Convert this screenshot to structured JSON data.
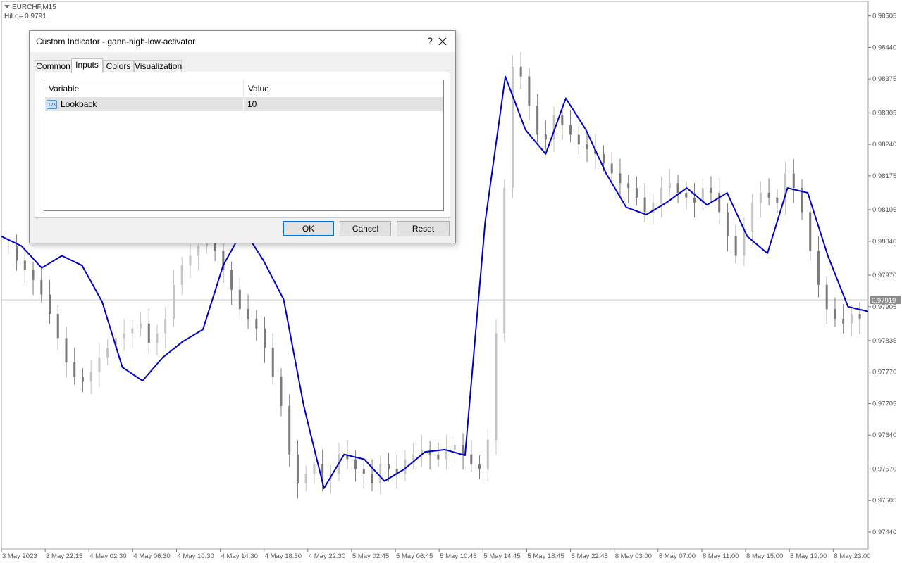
{
  "chart_data": {
    "type": "candlestick",
    "symbol": "EURCHF,M15",
    "indicator_readout": "HiLo= 0.9791",
    "current_price": "0.97919",
    "y_axis_ticks": [
      "0.98505",
      "0.98440",
      "0.98375",
      "0.98305",
      "0.98240",
      "0.98175",
      "0.98105",
      "0.98040",
      "0.97970",
      "0.97905",
      "0.97835",
      "0.97770",
      "0.97705",
      "0.97640",
      "0.97570",
      "0.97505",
      "0.97440"
    ],
    "y_range": [
      0.97405,
      0.98535
    ],
    "x_axis_labels": [
      "3 May 2023",
      "3 May 22:15",
      "4 May 02:30",
      "4 May 06:30",
      "4 May 10:30",
      "4 May 14:30",
      "4 May 18:30",
      "4 May 22:30",
      "5 May 02:45",
      "5 May 06:45",
      "5 May 10:45",
      "5 May 14:45",
      "5 May 18:45",
      "5 May 22:45",
      "8 May 03:00",
      "8 May 07:00",
      "8 May 11:00",
      "8 May 15:00",
      "8 May 19:00",
      "8 May 23:00"
    ],
    "series": [
      {
        "name": "HiLo",
        "color": "#0000c8",
        "values": [
          0.9805,
          0.9803,
          0.97985,
          0.9801,
          0.9799,
          0.97915,
          0.9778,
          0.97752,
          0.978,
          0.97833,
          0.97858,
          0.9799,
          0.98065,
          0.98,
          0.9792,
          0.977,
          0.9753,
          0.976,
          0.9759,
          0.97545,
          0.9757,
          0.97605,
          0.9761,
          0.97598,
          0.9808,
          0.9838,
          0.9827,
          0.9822,
          0.98335,
          0.9827,
          0.9818,
          0.9811,
          0.98095,
          0.9812,
          0.9815,
          0.98115,
          0.9814,
          0.9805,
          0.98015,
          0.9815,
          0.9814,
          0.9801,
          0.97905,
          0.97895
        ]
      }
    ],
    "candles_close": [
      0.9803,
      0.98,
      0.9798,
      0.9796,
      0.9793,
      0.9789,
      0.9784,
      0.9779,
      0.9776,
      0.9775,
      0.9777,
      0.978,
      0.9782,
      0.9784,
      0.9785,
      0.9786,
      0.9787,
      0.9783,
      0.9785,
      0.9788,
      0.9795,
      0.9799,
      0.9801,
      0.9803,
      0.9805,
      0.9802,
      0.9798,
      0.9794,
      0.979,
      0.9788,
      0.9786,
      0.9782,
      0.9776,
      0.977,
      0.976,
      0.9754,
      0.9756,
      0.9758,
      0.9755,
      0.9756,
      0.976,
      0.9759,
      0.9757,
      0.9756,
      0.9754,
      0.9758,
      0.9757,
      0.9756,
      0.9759,
      0.976,
      0.9761,
      0.976,
      0.9759,
      0.9761,
      0.9762,
      0.976,
      0.9758,
      0.9757,
      0.9763,
      0.9785,
      0.9815,
      0.984,
      0.9838,
      0.9832,
      0.9826,
      0.9825,
      0.983,
      0.9828,
      0.9826,
      0.9824,
      0.9823,
      0.9822,
      0.982,
      0.9818,
      0.9816,
      0.9815,
      0.9813,
      0.981,
      0.9812,
      0.9815,
      0.9816,
      0.9814,
      0.9813,
      0.9812,
      0.9815,
      0.9814,
      0.981,
      0.9805,
      0.9801,
      0.9806,
      0.9812,
      0.9814,
      0.9813,
      0.9812,
      0.9818,
      0.9815,
      0.981,
      0.9802,
      0.9795,
      0.979,
      0.9788,
      0.9787,
      0.9789,
      0.9788
    ]
  },
  "dialog": {
    "title": "Custom Indicator - gann-high-low-activator",
    "help_symbol": "?",
    "tabs": [
      "Common",
      "Inputs",
      "Colors",
      "Visualization"
    ],
    "active_tab": "Inputs",
    "table": {
      "headers": [
        "Variable",
        "Value"
      ],
      "rows": [
        {
          "icon": "123",
          "variable": "Lookback",
          "value": "10"
        }
      ]
    },
    "buttons": {
      "ok": "OK",
      "cancel": "Cancel",
      "reset": "Reset"
    }
  },
  "icons": {
    "close": "close-icon",
    "param_type": "integer-param-icon"
  }
}
